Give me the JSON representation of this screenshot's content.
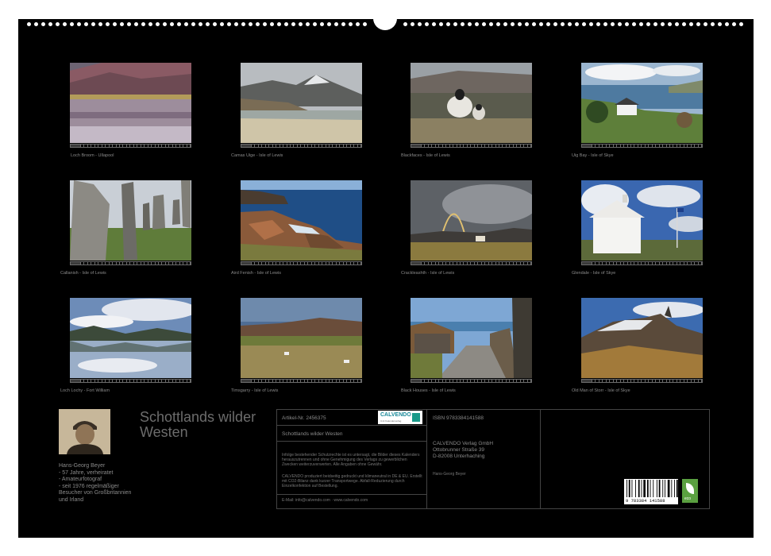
{
  "calendar": {
    "title": "Schottlands wilder Westen",
    "photos": [
      {
        "caption": "Loch Broom - Ullapool"
      },
      {
        "caption": "Camas Uige - Isle of Lewis"
      },
      {
        "caption": "Blackfaces - Isle of Lewis"
      },
      {
        "caption": "Uig Bay - Isle of Skye"
      },
      {
        "caption": "Callanish - Isle of Lewis"
      },
      {
        "caption": "Aird Fenish - Isle of Lewis"
      },
      {
        "caption": "Crackleashth - Isle of Lewis"
      },
      {
        "caption": "Glendale - Isle of Skye"
      },
      {
        "caption": "Loch Lochy - Fort William"
      },
      {
        "caption": "Timsgarry - Isle of Lewis"
      },
      {
        "caption": "Black Houses - Isle of Lewis"
      },
      {
        "caption": "Old Man of Storr - Isle of Skye"
      }
    ],
    "author": {
      "name": "Hans-Georg Beyer",
      "bio": "- 57 Jahre, verheiratet\n- Amateurfotograf\n- seit 1976 regelmäßiger Besucher von Großbritannien und Irland"
    },
    "info": {
      "article_no": "Artikel-Nr. 2456375",
      "calvendo_logo": "CALVENDO",
      "calvendo_tagline": "Unit Kalenderverlag",
      "product_title": "Schottlands wilder Westen",
      "legal_1": "Infolge bestehender Schutzrechte ist es untersagt, die Bilder dieses Kalenders herauszutrennen und ohne Genehmigung des Verlags zu gewerblichen Zwecken weiterzuverwerten. Alle Angaben ohne Gewähr.",
      "legal_2": "CALVENDO produziert beidseitig gedruckt und klimaneutral in DE & EU. Erstellt mit CO2-Bilanz dank kurzer Transportwege. Abfall-Reduzierung durch Einzelkonfektion auf Bestellung.",
      "contact": "E-Mail: info@calvendo.com · www.calvendo.com",
      "isbn": "ISBN 9783384141588",
      "publisher": "CALVENDO Verlag GmbH\nOttobrunner Straße 39\nD-82008 Unterhaching",
      "photographer": "Hans-Georg Beyer",
      "barcode_number": "9 783384 141588",
      "eco_label": "eco"
    }
  }
}
